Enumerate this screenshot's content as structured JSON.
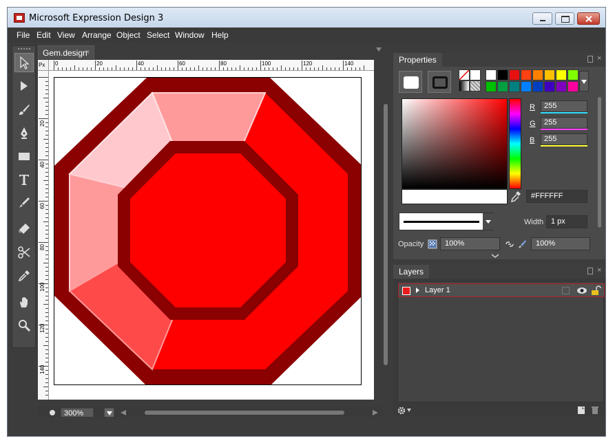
{
  "window": {
    "title": "Microsoft Expression Design 3"
  },
  "menu": [
    "File",
    "Edit",
    "View",
    "Arrange",
    "Object",
    "Select",
    "Window",
    "Help"
  ],
  "document": {
    "tab_label": "Gem.design",
    "tab_close": "×",
    "ruler_unit": "Px",
    "ruler_h_labels": [
      "0",
      "20",
      "40",
      "60",
      "80",
      "100",
      "120",
      "140"
    ],
    "ruler_v_labels": [
      "20",
      "40",
      "60",
      "80",
      "100",
      "120",
      "140"
    ],
    "zoom": "300%"
  },
  "tools": [
    "selection-arrow-icon",
    "direct-select-icon",
    "brush-icon",
    "pen-icon",
    "rectangle-icon",
    "text-icon",
    "paint-brush-icon",
    "eraser-icon",
    "scissors-icon",
    "eyedropper-icon",
    "hand-icon",
    "zoom-icon"
  ],
  "properties": {
    "title": "Properties",
    "r_label": "R",
    "r_value": "255",
    "g_label": "G",
    "g_value": "255",
    "b_label": "B",
    "b_value": "255",
    "hex": "#FFFFFF",
    "width_label": "Width",
    "width_value": "1 px",
    "opacity_label": "Opacity",
    "opacity_value": "100%",
    "opacity2_value": "100%",
    "swatches_row1": [
      "#ffffff",
      "#000000",
      "#e81010",
      "#ff4010",
      "#ff8000",
      "#ffc000",
      "#ffff00",
      "#80ff00"
    ],
    "swatches_row2": [
      "#00c000",
      "#00a040",
      "#008080",
      "#0080ff",
      "#0040c0",
      "#4000c0",
      "#8000c0",
      "#ff00a0"
    ]
  },
  "layers": {
    "title": "Layers",
    "items": [
      {
        "name": "Layer 1",
        "color": "#e81c1c"
      }
    ]
  },
  "colors": {
    "gem_dark": "#8b0000",
    "gem_red": "#ff0000",
    "gem_pink_light": "#ffc8cc",
    "gem_pink_mid": "#ff9a9a",
    "gem_pink_strong": "#ff4a4a"
  }
}
